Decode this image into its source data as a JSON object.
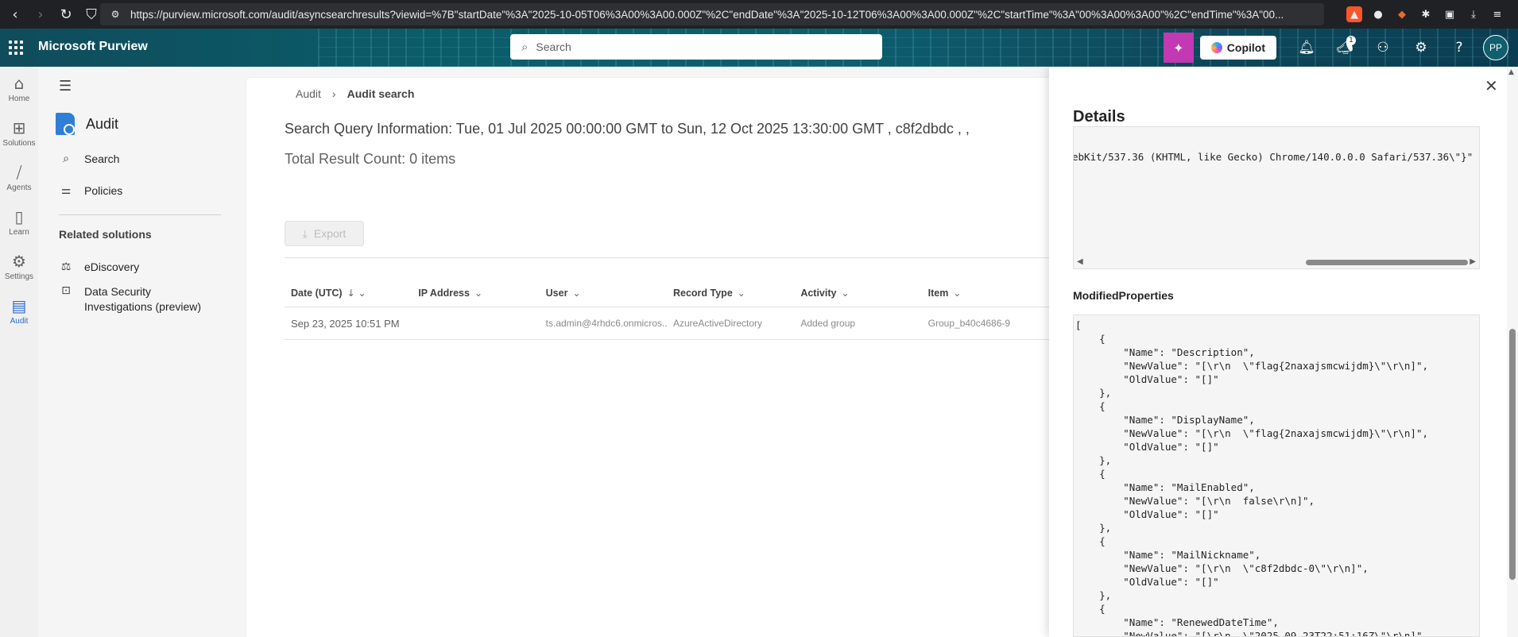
{
  "browser": {
    "url": "https://purview.microsoft.com/audit/asyncsearchresults?viewid=%7B\"startDate\"%3A\"2025-10-05T06%3A00%3A00.000Z\"%2C\"endDate\"%3A\"2025-10-12T06%3A00%3A00.000Z\"%2C\"startTime\"%3A\"00%3A00%3A00\"%2C\"endTime\"%3A\"00..."
  },
  "header": {
    "brand": "Microsoft Purview",
    "search_placeholder": "Search",
    "copilot_label": "Copilot",
    "notification_count": "1",
    "avatar_initials": "PP"
  },
  "rail": {
    "items": [
      {
        "label": "Home",
        "icon": "home-icon"
      },
      {
        "label": "Solutions",
        "icon": "solutions-icon"
      },
      {
        "label": "Agents",
        "icon": "agents-icon"
      },
      {
        "label": "Learn",
        "icon": "learn-icon"
      },
      {
        "label": "Settings",
        "icon": "settings-icon"
      },
      {
        "label": "Audit",
        "icon": "audit-icon"
      }
    ]
  },
  "sidenav": {
    "app_title": "Audit",
    "items": [
      {
        "label": "Search",
        "icon": "search-icon"
      },
      {
        "label": "Policies",
        "icon": "policies-icon"
      }
    ],
    "related_title": "Related solutions",
    "related": [
      {
        "label": "eDiscovery",
        "icon": "ediscovery-icon"
      },
      {
        "label": "Data Security Investigations (preview)",
        "icon": "data-security-icon"
      }
    ]
  },
  "main": {
    "breadcrumb": [
      "Audit",
      "Audit search"
    ],
    "query_title": "Search Query Information: Tue, 01 Jul 2025 00:00:00 GMT to Sun, 12 Oct 2025 13:30:00 GMT , c8f2dbdc , ,",
    "result_count": "Total Result Count: 0 items",
    "export_label": "Export",
    "columns": [
      "Date (UTC)",
      "IP Address",
      "User",
      "Record Type",
      "Activity",
      "Item"
    ],
    "rows": [
      {
        "date": "Sep 23, 2025 10:51 PM",
        "ip": "",
        "user": "ts.admin@4rhdc6.onmicros...",
        "record_type": "AzureActiveDirectory",
        "activity": "Added group",
        "item": "Group_b40c4686-9"
      }
    ]
  },
  "details": {
    "title": "Details",
    "code_line": "ebKit/537.36 (KHTML, like Gecko) Chrome/140.0.0.0 Safari/537.36\\\"}\"",
    "modified_label": "ModifiedProperties",
    "modified_json": "[\n    {\n        \"Name\": \"Description\",\n        \"NewValue\": \"[\\r\\n  \\\"flag{2naxajsmcwijdm}\\\"\\r\\n]\",\n        \"OldValue\": \"[]\"\n    },\n    {\n        \"Name\": \"DisplayName\",\n        \"NewValue\": \"[\\r\\n  \\\"flag{2naxajsmcwijdm}\\\"\\r\\n]\",\n        \"OldValue\": \"[]\"\n    },\n    {\n        \"Name\": \"MailEnabled\",\n        \"NewValue\": \"[\\r\\n  false\\r\\n]\",\n        \"OldValue\": \"[]\"\n    },\n    {\n        \"Name\": \"MailNickname\",\n        \"NewValue\": \"[\\r\\n  \\\"c8f2dbdc-0\\\"\\r\\n]\",\n        \"OldValue\": \"[]\"\n    },\n    {\n        \"Name\": \"RenewedDateTime\",\n        \"NewValue\": \"[\\r\\n  \\\"2025-09-23T22:51:16Z\\\"\\r\\n]\","
  }
}
